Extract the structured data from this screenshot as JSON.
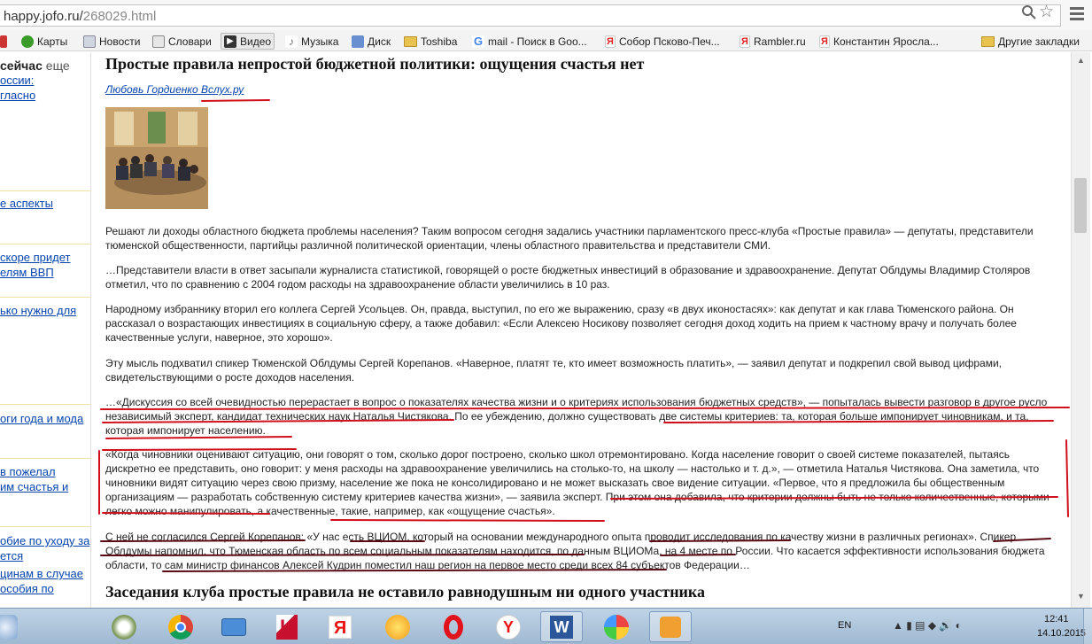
{
  "browser": {
    "url_host": "happy.jofo.ru/",
    "url_path": "268029.html"
  },
  "bookmarks": [
    {
      "label": "",
      "icon": "partial-icon"
    },
    {
      "label": "Карты",
      "icon": "maps-icon"
    },
    {
      "label": "Новости",
      "icon": "news-icon"
    },
    {
      "label": "Словари",
      "icon": "dictionary-icon"
    },
    {
      "label": "Видео",
      "icon": "video-icon"
    },
    {
      "label": "Музыка",
      "icon": "music-icon"
    },
    {
      "label": "Диск",
      "icon": "disk-icon"
    },
    {
      "label": "Toshiba",
      "icon": "folder-icon"
    },
    {
      "label": "mail - Поиск в Goo...",
      "icon": "google-icon"
    },
    {
      "label": "Собор Псково-Печ...",
      "icon": "yandex-icon"
    },
    {
      "label": "Rambler.ru",
      "icon": "yandex-icon"
    },
    {
      "label": "Константин Яросла...",
      "icon": "yandex-icon"
    },
    {
      "label": "Другие закладки",
      "icon": "folder-icon"
    }
  ],
  "sidebar": {
    "now_bold": "сейчас",
    "now_rest": " еще",
    "links": [
      "оссии:",
      "гласно",
      "е аспекты",
      "скоре придет",
      "елям ВВП",
      "ько нужно для",
      "оги года и мода",
      "в пожелал",
      "им счастья и",
      "обие по уходу за",
      "ется",
      "цинам в случае",
      "особия по"
    ]
  },
  "article": {
    "title": "Простые правила непростой бюджетной политики: ощущения счастья нет",
    "author": "Любовь Гордиенко Вслух.ру",
    "paragraphs": [
      "Решают ли доходы областного бюджета проблемы населения? Таким вопросом сегодня задались участники парламентского пресс-клуба «Простые правила» — депутаты, представители тюменской общественности, партийцы различной политической ориентации, члены областного правительства и представители СМИ.",
      "…Представители власти в ответ засыпали журналиста статистикой, говорящей о росте бюджетных инвестиций в образование и здравоохранение. Депутат Облдумы Владимир Столяров отметил, что по сравнению с 2004 годом расходы на здравоохранение области увеличились в 10 раз.",
      "Народному избраннику вторил его коллега Сергей Усольцев. Он, правда, выступил, по его же выражению, сразу «в двух иконостасях»: как депутат и как глава Тюменского района. Он рассказал о возрастающих инвестициях в социальную сферу, а также добавил: «Если Алексею Носикову позволяет сегодня доход ходить на прием к частному врачу и получать более качественные услуги, наверное, это хорошо».",
      "Эту мысль подхватил спикер Тюменской Облдумы Сергей Корепанов. «Наверное, платят те, кто имеет возможность платить», — заявил депутат и подкрепил свой вывод цифрами, свидетельствующими о росте доходов населения.",
      "…«Дискуссия со всей очевидностью перерастает в вопрос о показателях качества жизни и о критериях использования бюджетных средств», — попыталась вывести разговор в другое русло независимый эксперт, кандидат технических наук Наталья Чистякова. По ее убеждению, должно существовать две системы критериев: та, которая больше импонирует чиновникам, и та, которая импонирует населению.",
      "«Когда чиновники оценивают ситуацию, они говорят о том, сколько дорог построено, сколько школ отремонтировано. Когда население говорит о своей системе показателей, пытаясь дискретно ее представить, оно говорит: у меня расходы на здравоохранение увеличились на столько-то, на школу — настолько и т. д.», — отметила Наталья Чистякова. Она заметила, что чиновники видят ситуацию через свою призму, население же пока не консолидировано и не может высказать свое видение ситуации. «Первое, что я предложила бы общественным организациям — разработать собственную систему критериев качества жизни», — заявила эксперт. При этом она добавила, что критерии должны быть не только количественные, которыми легко можно манипулировать, а качественные, такие, например, как «ощущение счастья».",
      "С ней не согласился Сергей Корепанов: «У нас есть ВЦИОМ, который на основании международного опыта проводит исследования по качеству жизни в различных регионах». Спикер Облдумы напомнил, что Тюменская область по всем социальным показателям находится, по данным ВЦИОМа, на 4 месте по России. Что касается эффективности использования бюджета области, то сам министр финансов Алексей Кудрин поместил наш регион на первое место среди всех 84 субъектов Федерации…"
    ],
    "subtitle": "Заседания клуба простые правила не оставило равнодушным ни одного участника"
  },
  "taskbar": {
    "apps": [
      "start-icon",
      "media-icon",
      "chrome-icon",
      "mail-icon",
      "kaspersky-icon",
      "yandex-icon",
      "sun-icon",
      "opera-icon",
      "yandex-browser-icon",
      "word-icon",
      "paint-icon",
      "app-icon"
    ],
    "lang": "EN",
    "time": "12:41",
    "date": "14.10.2015"
  },
  "colors": {
    "link": "#0645ad",
    "mark_red": "#d0101c",
    "mark_dark": "#5a0a14"
  }
}
